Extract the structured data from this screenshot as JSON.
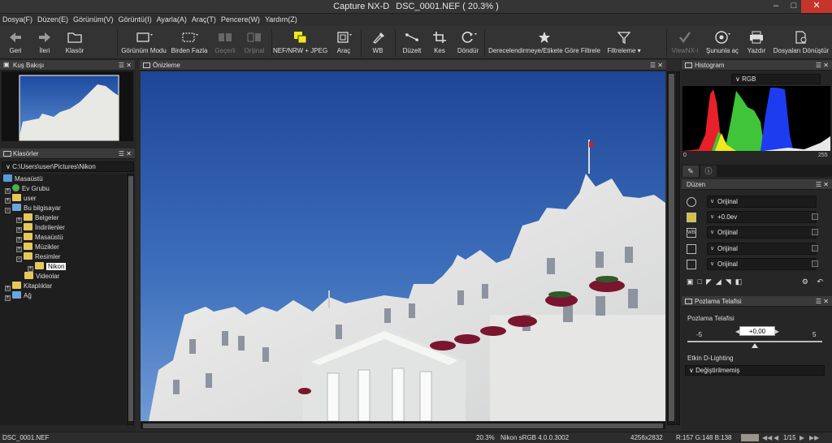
{
  "window": {
    "app_title": "Capture NX-D",
    "doc_title": "DSC_0001.NEF ( 20.3% )",
    "minimize": "–",
    "maximize": "□",
    "close": "✕"
  },
  "menu": [
    "Dosya(F)",
    "Düzen(E)",
    "Görünüm(V)",
    "Görüntü(I)",
    "Ayarla(A)",
    "Araç(T)",
    "Pencere(W)",
    "Yardım(Z)"
  ],
  "toolbar": {
    "back": "Geri",
    "forward": "İleri",
    "folder": "Klasör",
    "view_mode": "Görünüm Modu",
    "multiple": "Birden Fazla",
    "current": "Geçerli",
    "original": "Orijinal",
    "nef_jpeg": "NEF/NRW + JPEG",
    "tool": "Araç",
    "wb": "WB",
    "straighten": "Düzelt",
    "crop": "Kes",
    "rotate": "Döndür",
    "rating_filter": "Derecelendirmeye/Etikete Göre Filtrele",
    "filtering": "Filtreleme",
    "viewnx": "ViewNX-i",
    "open_with": "Şununla aç",
    "print": "Yazdır",
    "convert": "Dosyaları Dönüştür"
  },
  "birdseye": {
    "title": "Kuş Bakışı"
  },
  "folders": {
    "title": "Klasörler",
    "path": "C:\\Users\\user\\Pictures\\Nikon",
    "items": [
      "Masaüstü",
      "Ev Grubu",
      "user",
      "Bu bilgisayar",
      "Belgeler",
      "İndirilenler",
      "Masaüstü",
      "Müzikler",
      "Resimler",
      "Nikon",
      "Videolar",
      "Kitaplıklar",
      "Ağ"
    ]
  },
  "preview": {
    "title": "Önizleme"
  },
  "histogram": {
    "title": "Histogram",
    "channel": "RGB",
    "min": "0",
    "max": "255",
    "colors": {
      "red": "#e8202a",
      "green": "#3fc43a",
      "blue": "#1d3cf0",
      "yellow": "#f3e81e"
    }
  },
  "adjust": {
    "title": "Düzen",
    "rows": [
      "Orijinal",
      "+0.0ev",
      "Orijinal",
      "Orijinal",
      "Orijinal"
    ]
  },
  "exposure": {
    "title": "Pozlama Telafisi",
    "label": "Pozlama Telafisi",
    "min": "-5",
    "max": "5",
    "value": "+0,00",
    "level": 0.5
  },
  "dlighting": {
    "label": "Etkin D-Lighting",
    "value": "Değiştirilmemiş"
  },
  "status": {
    "file": "DSC_0001.NEF",
    "zoom": "20.3%",
    "profile": "Nikon sRGB 4.0.0.3002",
    "size": "4256x2832",
    "rgb": "R:157 G:148 B:138",
    "swatch": "#9d948a",
    "page": "1/15"
  }
}
